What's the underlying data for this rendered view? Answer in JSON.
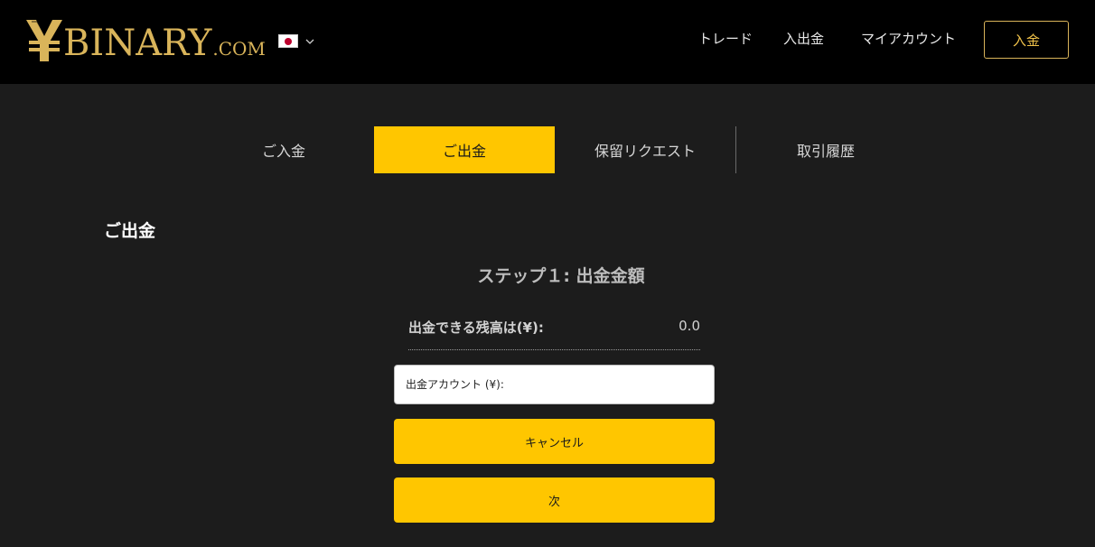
{
  "header": {
    "logo": {
      "text": "BINARY",
      "suffix": ".COM"
    },
    "language": {
      "flag_icon": "japan-flag-icon",
      "dropdown_icon": "chevron-down-icon"
    },
    "nav": [
      {
        "label": "トレード"
      },
      {
        "label": "入出金"
      },
      {
        "label": "マイアカウント"
      }
    ],
    "deposit_button": "入金"
  },
  "tabs": [
    {
      "label": "ご入金",
      "active": false
    },
    {
      "label": "ご出金",
      "active": true
    },
    {
      "label": "保留リクエスト",
      "active": false
    },
    {
      "label": "取引履歴",
      "active": false
    }
  ],
  "main": {
    "section_title": "ご出金",
    "step_title": "ステップ１: 出金金額",
    "balance": {
      "label": "出金できる残高は(¥):",
      "value": "0.0"
    },
    "account_input": {
      "placeholder": "出金アカウント (¥):",
      "value": ""
    },
    "cancel_button": "キャンセル",
    "next_button": "次"
  },
  "colors": {
    "accent": "#ffc600",
    "gold": "#d9b45a",
    "header_bg": "#000000",
    "page_bg": "#1c1c1c"
  }
}
